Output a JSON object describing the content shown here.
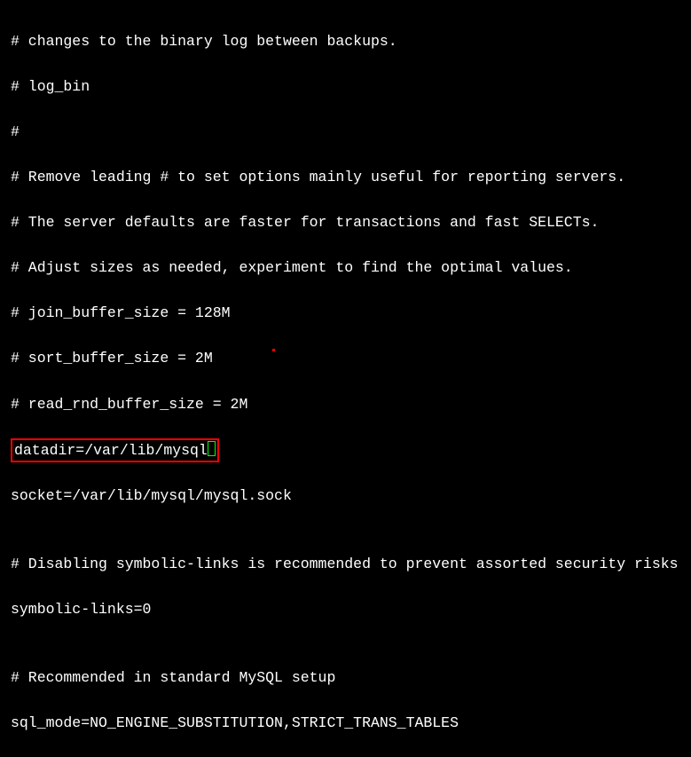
{
  "terminal": {
    "lines": {
      "l0": "# changes to the binary log between backups.",
      "l1": "# log_bin",
      "l2": "#",
      "l3": "# Remove leading # to set options mainly useful for reporting servers.",
      "l4": "# The server defaults are faster for transactions and fast SELECTs.",
      "l5": "# Adjust sizes as needed, experiment to find the optimal values.",
      "l6": "# join_buffer_size = 128M",
      "l7": "# sort_buffer_size = 2M",
      "l8": "# read_rnd_buffer_size = 2M",
      "l9_highlighted": "datadir=/var/lib/mysql",
      "l10": "socket=/var/lib/mysql/mysql.sock",
      "l11": "",
      "l12": "# Disabling symbolic-links is recommended to prevent assorted security risks",
      "l13": "symbolic-links=0",
      "l14": "",
      "l15": "# Recommended in standard MySQL setup",
      "l16": "sql_mode=NO_ENGINE_SUBSTITUTION,STRICT_TRANS_TABLES"
    }
  }
}
